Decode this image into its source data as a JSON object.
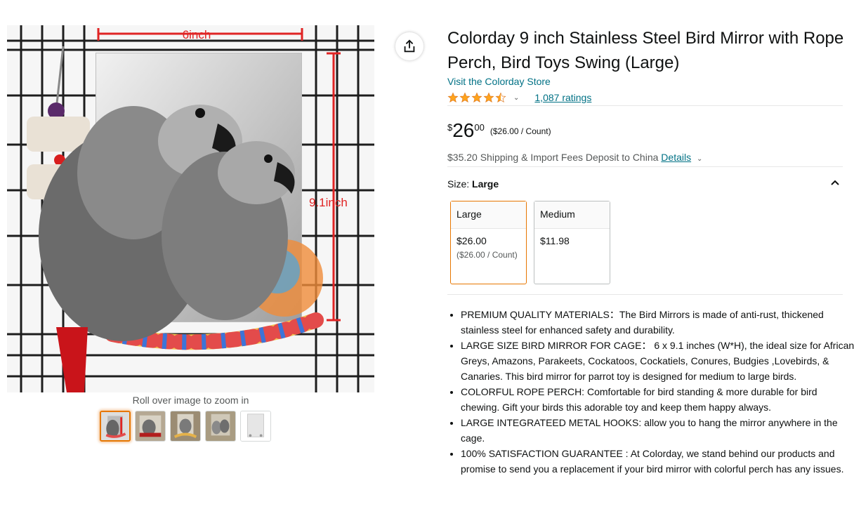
{
  "gallery": {
    "image_labels": {
      "width": "6inch",
      "height": "9.1inch"
    },
    "zoom_hint": "Roll over image to zoom in",
    "thumbnail_count": 5
  },
  "product": {
    "title": "Colorday 9 inch Stainless Steel Bird Mirror with Rope Perch, Bird Toys Swing (Large)",
    "store_link": "Visit the Colorday Store",
    "rating": 4.5,
    "ratings_count": "1,087 ratings"
  },
  "price": {
    "symbol": "$",
    "whole": "26",
    "fraction": "00",
    "unit_price": "($26.00 / Count)"
  },
  "shipping": {
    "text": "$35.20 Shipping & Import Fees Deposit to China",
    "details_link": "Details"
  },
  "size": {
    "label": "Size:",
    "selected": "Large",
    "options": [
      {
        "name": "Large",
        "price": "$26.00",
        "unit": "($26.00 / Count)"
      },
      {
        "name": "Medium",
        "price": "$11.98",
        "unit": ""
      }
    ]
  },
  "features": [
    "PREMIUM QUALITY MATERIALS：The Bird Mirrors is made of anti-rust, thickened stainless steel for enhanced safety and durability.",
    "LARGE SIZE BIRD MIRROR FOR CAGE：  6 x 9.1 inches (W*H), the ideal size for African Greys, Amazons, Parakeets, Cockatoos, Cockatiels, Conures, Budgies ,Lovebirds, & Canaries. This bird mirror for parrot toy is designed for medium to large birds.",
    "COLORFUL ROPE PERCH: Comfortable for bird standing & more durable for bird chewing. Gift your birds this adorable toy and keep them happy always.",
    "LARGE INTEGRATEED METAL HOOKS: allow you to hang the mirror anywhere in the cage.",
    "100% SATISFACTION GUARANTEE : At Colorday, we stand behind our products and promise to send you a replacement if your bird mirror with colorful perch has any issues."
  ],
  "colors": {
    "link": "#007185",
    "star": "#ffa41c",
    "selected_border": "#e77600",
    "text": "#0f1111",
    "muted": "#565959"
  },
  "icons": {
    "share": "share-icon",
    "star": "star-icon",
    "caret": "chevron-down-icon",
    "collapse": "chevron-up-icon"
  }
}
